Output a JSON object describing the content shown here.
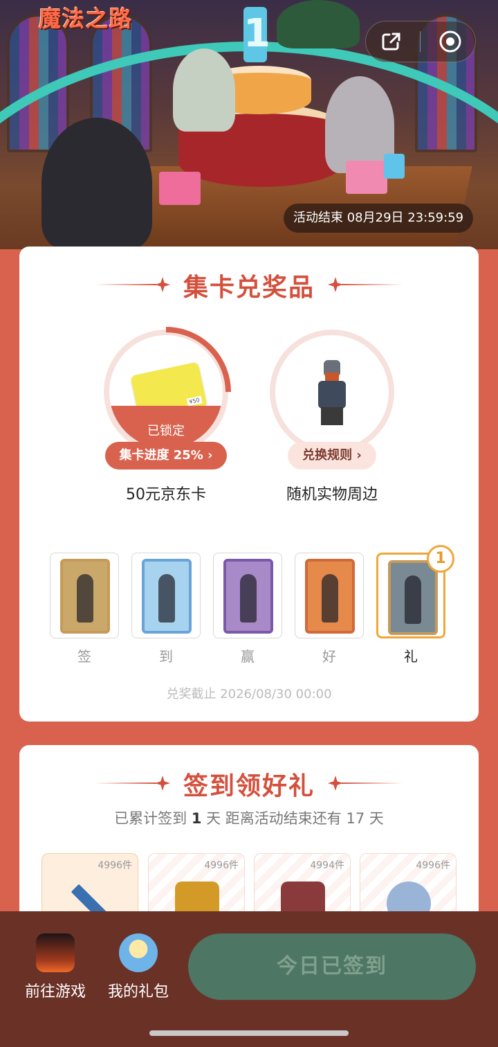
{
  "header": {
    "logo_text": "魔法之路",
    "share_icon": "share-icon",
    "record_icon": "record-icon",
    "event_end_label": "活动结束 08月29日 23:59:59",
    "banner_candle_number": "1"
  },
  "collect_section": {
    "title": "集卡兑奖品",
    "prizes": [
      {
        "name": "50元京东卡",
        "status": "已锁定",
        "action_label": "集卡进度 25%",
        "progress": 0.25,
        "card_value_text": "¥50"
      },
      {
        "name": "随机实物周边",
        "action_label": "兑换规则"
      }
    ],
    "cards": [
      {
        "label": "签",
        "frame_color": "#c69a5a",
        "bg": "#c9a86a",
        "owned": false
      },
      {
        "label": "到",
        "frame_color": "#6aa3d8",
        "bg": "#a8d3ee",
        "owned": false
      },
      {
        "label": "赢",
        "frame_color": "#7a5aa8",
        "bg": "#a98ac9",
        "owned": false
      },
      {
        "label": "好",
        "frame_color": "#d06a3a",
        "bg": "#e58a4a",
        "owned": false
      },
      {
        "label": "礼",
        "frame_color": "#c69a5a",
        "bg": "#7a8a94",
        "owned": true,
        "count": "1"
      }
    ],
    "deadline_label": "兑奖截止 2026/08/30 00:00"
  },
  "signin_section": {
    "title": "签到领好礼",
    "subtitle_prefix": "已累计签到 ",
    "days_signed": "1",
    "subtitle_mid": " 天  距离活动结束还有 17 天",
    "rewards": [
      {
        "stock": "4996件",
        "item_icon": "sword-icon",
        "item_color": "#3a6fb0"
      },
      {
        "stock": "4996件",
        "item_icon": "golden-helmet-icon",
        "item_color": "#d49a28"
      },
      {
        "stock": "4994件",
        "item_icon": "potion-icon",
        "item_color": "#8a3a3a"
      },
      {
        "stock": "4996件",
        "item_icon": "crystal-orb-icon",
        "item_color": "#9ab4d8"
      }
    ]
  },
  "bottom_bar": {
    "game_label": "前往游戏",
    "gifts_label": "我的礼包",
    "signed_label": "今日已签到"
  },
  "colors": {
    "page_bg": "#d9624e",
    "accent_red": "#d4503d",
    "card_highlight": "#f0a63a",
    "bottom_bar": "#6a3127",
    "signed_button": "#4e7664"
  }
}
